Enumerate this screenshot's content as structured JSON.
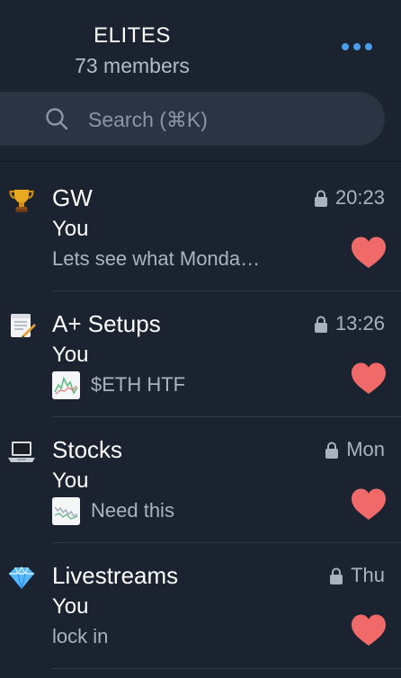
{
  "header": {
    "title": "ELITES",
    "subtitle": "73 members",
    "more_icon": "more-dots-icon"
  },
  "search": {
    "placeholder": "Search (⌘K)",
    "icon": "search-icon"
  },
  "chats": [
    {
      "avatar": "trophy-icon",
      "name": "GW",
      "time": "20:23",
      "sender": "You",
      "preview": "Lets see what Monda…",
      "has_thumb": false,
      "reaction": "heart-icon"
    },
    {
      "avatar": "memo-icon",
      "name": "A+ Setups",
      "time": "13:26",
      "sender": "You",
      "preview": "$ETH HTF",
      "has_thumb": true,
      "reaction": "heart-icon"
    },
    {
      "avatar": "laptop-icon",
      "name": "Stocks",
      "time": "Mon",
      "sender": "You",
      "preview": "Need this",
      "has_thumb": true,
      "reaction": "heart-icon"
    },
    {
      "avatar": "gem-icon",
      "name": "Livestreams",
      "time": "Thu",
      "sender": "You",
      "preview": "lock in",
      "has_thumb": false,
      "reaction": "heart-icon"
    }
  ],
  "colors": {
    "background": "#1b2330",
    "accent": "#4b9de8",
    "heart": "#f06a6a",
    "secondary_text": "#aab3c0"
  }
}
